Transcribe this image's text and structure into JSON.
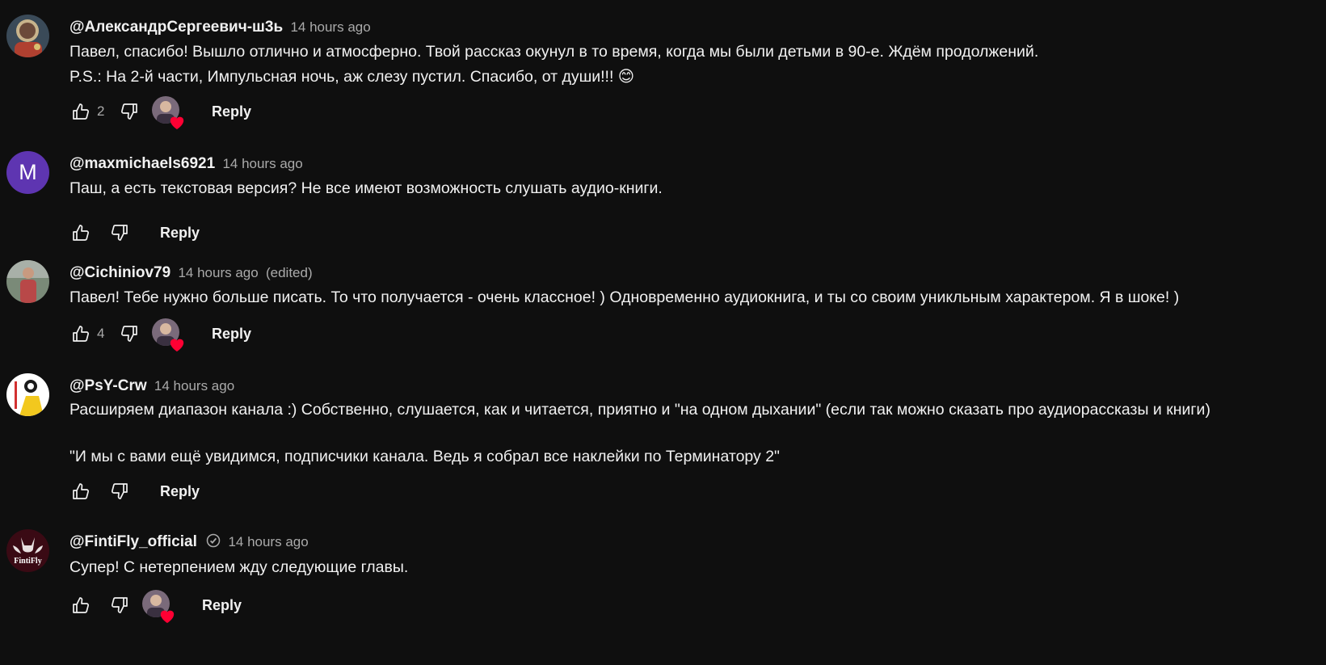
{
  "comments": [
    {
      "author": "@АлександрСергеевич-ш3ь",
      "time": "14 hours ago",
      "lines": [
        "Павел, спасибо! Вышло отлично и атмосферно. Твой рассказ окунул в то время, когда мы были детьми в 90-е. Ждём продолжений.",
        "P.S.: На 2-й части, Импульсная ночь, аж слезу пустил. Спасибо, от души!!! 😊"
      ],
      "likes": "2",
      "hearted": true,
      "reply_label": "Reply",
      "avatar_icon": "astronaut-avatar"
    },
    {
      "author": "@maxmichaels6921",
      "time": "14 hours ago",
      "avatar_letter": "M",
      "avatar_color": "#5e35b1",
      "lines": [
        "Паш, а есть текстовая версия? Не все имеют возможность слушать аудио-книги."
      ],
      "likes": "",
      "hearted": false,
      "reply_label": "Reply"
    },
    {
      "author": "@Cichiniov79",
      "time": "14 hours ago",
      "edited": "(edited)",
      "lines": [
        "Павел! Тебе нужно больше писать. То что получается - очень классное! ) Одновременно аудиокнига, и ты со своим уникльным характером. Я в шоке! )"
      ],
      "likes": "4",
      "hearted": true,
      "reply_label": "Reply",
      "avatar_icon": "photo-avatar"
    },
    {
      "author": "@PsY-Crw",
      "time": "14 hours ago",
      "lines": [
        "Расширяем диапазон канала :) Собственно, слушается, как и читается, приятно и \"на одном дыхании\" (если так можно сказать про аудиорассказы и книги)",
        "",
        "\"И мы с вами ещё увидимся, подписчики канала. Ведь я собрал все наклейки по Терминатору 2\""
      ],
      "likes": "",
      "hearted": false,
      "reply_label": "Reply",
      "avatar_icon": "cartoon-avatar"
    },
    {
      "author": "@FintiFly_official",
      "time": "14 hours ago",
      "verified": true,
      "lines": [
        "Супер! С нетерпением жду следующие главы."
      ],
      "likes": "",
      "hearted": true,
      "reply_label": "Reply",
      "avatar_logo_text": "FintiFly"
    }
  ],
  "colors": {
    "background": "#0f0f0f",
    "text": "#f1f1f1",
    "muted": "#aaaaaa",
    "heart": "#ff0033"
  }
}
